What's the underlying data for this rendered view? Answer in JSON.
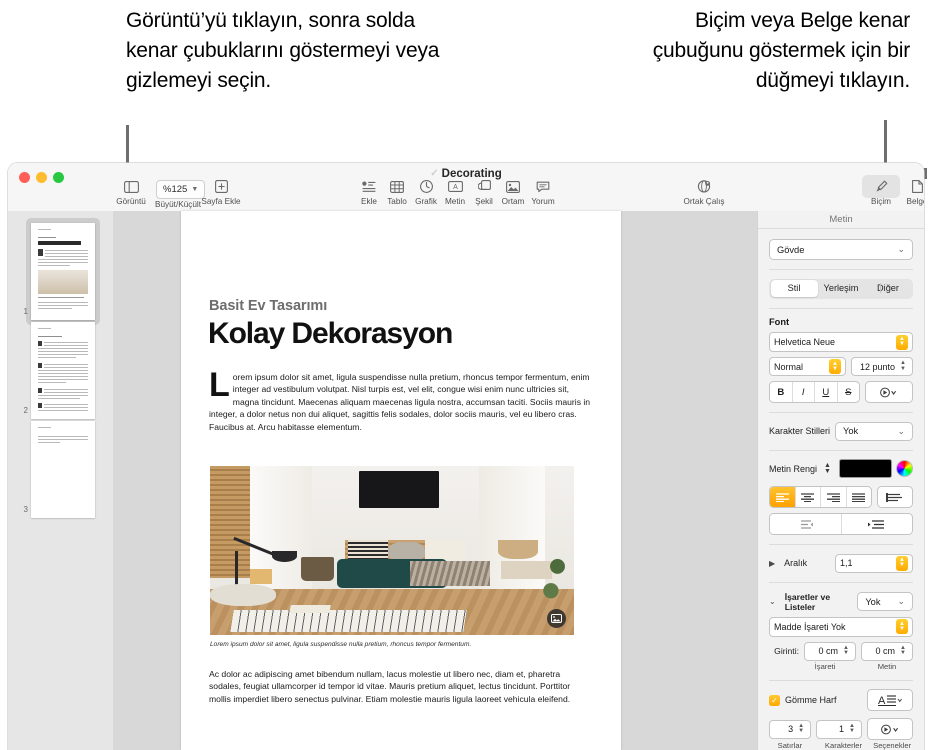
{
  "callouts": {
    "left": "Görüntü’yü tıklayın, sonra solda kenar çubuklarını göstermeyi veya gizlemeyi seçin.",
    "right": "Biçim veya Belge kenar çubuğunu göstermek için bir düğmeyi tıklayın."
  },
  "window": {
    "title": "Decorating",
    "traffic_lights": [
      "close",
      "minimize",
      "zoom"
    ]
  },
  "toolbar": {
    "view": {
      "label": "Görüntü",
      "icon": "sidebar-icon"
    },
    "zoom": {
      "label": "Büyüt/Küçült",
      "value": "%125",
      "icon": "chevron-down-icon"
    },
    "add_page": {
      "label": "Sayfa Ekle",
      "icon": "add-page-icon"
    },
    "insert": {
      "label": "Ekle",
      "icon": "insert-icon"
    },
    "table": {
      "label": "Tablo",
      "icon": "table-icon"
    },
    "chart": {
      "label": "Grafik",
      "icon": "chart-icon"
    },
    "text": {
      "label": "Metin",
      "icon": "text-box-icon"
    },
    "shape": {
      "label": "Şekil",
      "icon": "shape-icon"
    },
    "media": {
      "label": "Ortam",
      "icon": "media-icon"
    },
    "comment": {
      "label": "Yorum",
      "icon": "comment-icon"
    },
    "collaborate": {
      "label": "Ortak Çalış",
      "icon": "collaborate-icon"
    },
    "format": {
      "label": "Biçim",
      "icon": "paintbrush-icon",
      "active": true
    },
    "document": {
      "label": "Belge",
      "icon": "document-icon",
      "active": false
    }
  },
  "thumbnails": {
    "pages": [
      {
        "number": "1",
        "selected": true
      },
      {
        "number": "2",
        "selected": false
      },
      {
        "number": "3",
        "selected": false
      }
    ]
  },
  "document_page": {
    "eyebrow": "Basit Ev Tasarımı",
    "headline": "Kolay Dekorasyon",
    "dropcap": "L",
    "body1": "orem ipsum dolor sit amet, ligula suspendisse nulla pretium, rhoncus tempor fermentum, enim integer ad vestibulum volutpat. Nisl turpis est, vel elit, congue wisi enim nunc ultricies sit, magna tincidunt. Maecenas aliquam maecenas ligula nostra, accumsan taciti. Sociis mauris in integer, a dolor netus non dui aliquet, sagittis felis sodales, dolor sociis mauris, vel eu libero cras. Faucibus at. Arcu habitasse elementum.",
    "image_alt": "living-room-photo",
    "image_badge_icon": "image-placeholder-icon",
    "caption": "Lorem ipsum dolor sit amet, ligula suspendisse nulla pretium, rhoncus tempor fermentum.",
    "body2": "Ac dolor ac adipiscing amet bibendum nullam, lacus molestie ut libero nec, diam et, pharetra sodales, feugiat ullamcorper id tempor id vitae. Mauris pretium aliquet, lectus tincidunt. Porttitor mollis imperdiet libero senectus pulvinar. Etiam molestie mauris ligula laoreet vehicula eleifend."
  },
  "sidebar": {
    "title": "Metin",
    "paragraph_style": "Gövde",
    "tabs": [
      {
        "label": "Stil",
        "selected": true
      },
      {
        "label": "Yerleşim",
        "selected": false
      },
      {
        "label": "Diğer",
        "selected": false
      }
    ],
    "font": {
      "section_label": "Font",
      "family": "Helvetica Neue",
      "weight": "Normal",
      "size": "12 punto",
      "styles": [
        "B",
        "I",
        "U",
        "S"
      ],
      "more_icon": "gear-popup-icon"
    },
    "character_styles": {
      "label": "Karakter Stilleri",
      "value": "Yok"
    },
    "text_color": {
      "label": "Metin Rengi",
      "swatch": "#000000",
      "wheel_icon": "color-wheel-icon"
    },
    "alignment": {
      "buttons": [
        "align-left",
        "align-center",
        "align-right",
        "align-justify"
      ],
      "selected": "align-left",
      "vertical_icon": "align-vertical-icon",
      "outdent_icon": "outdent-icon",
      "indent_icon": "indent-icon"
    },
    "spacing": {
      "label": "Aralık",
      "value": "1,1"
    },
    "bullets": {
      "label": "İşaretler ve Listeler",
      "value": "Yok",
      "bullet_style": "Madde İşareti Yok",
      "indent_label": "Girinti:",
      "indent_bullet_value": "0 cm",
      "indent_bullet_label": "İşareti",
      "indent_text_value": "0 cm",
      "indent_text_label": "Metin"
    },
    "drop_cap": {
      "label": "Gömme Harf",
      "checked": true,
      "style_icon": "drop-cap-style-icon",
      "lines_value": "3",
      "lines_label": "Satırlar",
      "chars_value": "1",
      "chars_label": "Karakterler",
      "options_label": "Seçenekler",
      "options_icon": "options-gear-icon"
    }
  },
  "colors": {
    "accent_orange": "#FFB000",
    "toolbar_bg": "#F6F6F6",
    "sidebar_bg": "#F2F2F2",
    "canvas_bg": "#D8D8D8",
    "thumbs_bg": "#E6E6E6"
  }
}
